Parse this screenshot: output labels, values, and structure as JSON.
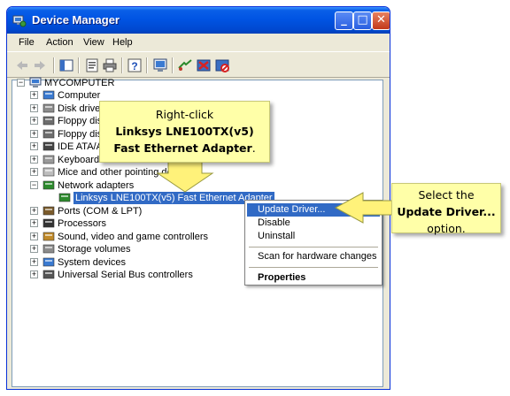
{
  "window": {
    "title": "Device Manager",
    "minimize_glyph": "_",
    "maximize_glyph": "□",
    "close_glyph": "✕"
  },
  "menu": {
    "items": [
      "File",
      "Action",
      "View",
      "Help"
    ]
  },
  "toolbar": {
    "buttons": [
      "back-arrow-icon",
      "forward-arrow-icon",
      "console-tree-icon",
      "properties-icon",
      "print-icon",
      "help-icon",
      "scan-hardware-icon",
      "update-driver-icon",
      "uninstall-icon",
      "disable-icon"
    ]
  },
  "tree": {
    "root": "MYCOMPUTER",
    "nodes": [
      {
        "label": "Computer",
        "icon": "computer-icon",
        "expander": "+"
      },
      {
        "label": "Disk drives",
        "icon": "disk-drive-icon",
        "expander": "+"
      },
      {
        "label": "Floppy disk controllers",
        "icon": "floppy-controller-icon",
        "expander": "+"
      },
      {
        "label": "Floppy disk drives",
        "icon": "floppy-drive-icon",
        "expander": "+"
      },
      {
        "label": "IDE ATA/ATAPI controllers",
        "icon": "ide-controller-icon",
        "expander": "+"
      },
      {
        "label": "Keyboards",
        "icon": "keyboard-icon",
        "expander": "+"
      },
      {
        "label": "Mice and other pointing devices",
        "icon": "mouse-icon",
        "expander": "+"
      },
      {
        "label": "Network adapters",
        "icon": "network-adapter-icon",
        "expander": "−"
      },
      {
        "label": "Linksys LNE100TX(v5) Fast Ethernet Adapter",
        "icon": "network-card-icon",
        "expander": ""
      },
      {
        "label": "Ports (COM & LPT)",
        "icon": "port-icon",
        "expander": "+"
      },
      {
        "label": "Processors",
        "icon": "processor-icon",
        "expander": "+"
      },
      {
        "label": "Sound, video and game controllers",
        "icon": "sound-icon",
        "expander": "+"
      },
      {
        "label": "Storage volumes",
        "icon": "storage-icon",
        "expander": "+"
      },
      {
        "label": "System devices",
        "icon": "system-device-icon",
        "expander": "+"
      },
      {
        "label": "Universal Serial Bus controllers",
        "icon": "usb-icon",
        "expander": "+"
      }
    ]
  },
  "context_menu": {
    "items": [
      "Update Driver...",
      "Disable",
      "Uninstall",
      "Scan for hardware changes",
      "Properties"
    ]
  },
  "callouts": {
    "first": {
      "line1": "Right-click",
      "line2": "Linksys LNE100TX(v5)",
      "line3_bold": "Fast Ethernet Adapter",
      "line3_tail": "."
    },
    "second": {
      "line1": "Select the",
      "line2": "Update Driver...",
      "line3": "option."
    }
  },
  "colors": {
    "titlebar": "#0054e3",
    "selection": "#316ac5",
    "callout_bg": "#ffffa8",
    "arrow": "#fff27a"
  }
}
